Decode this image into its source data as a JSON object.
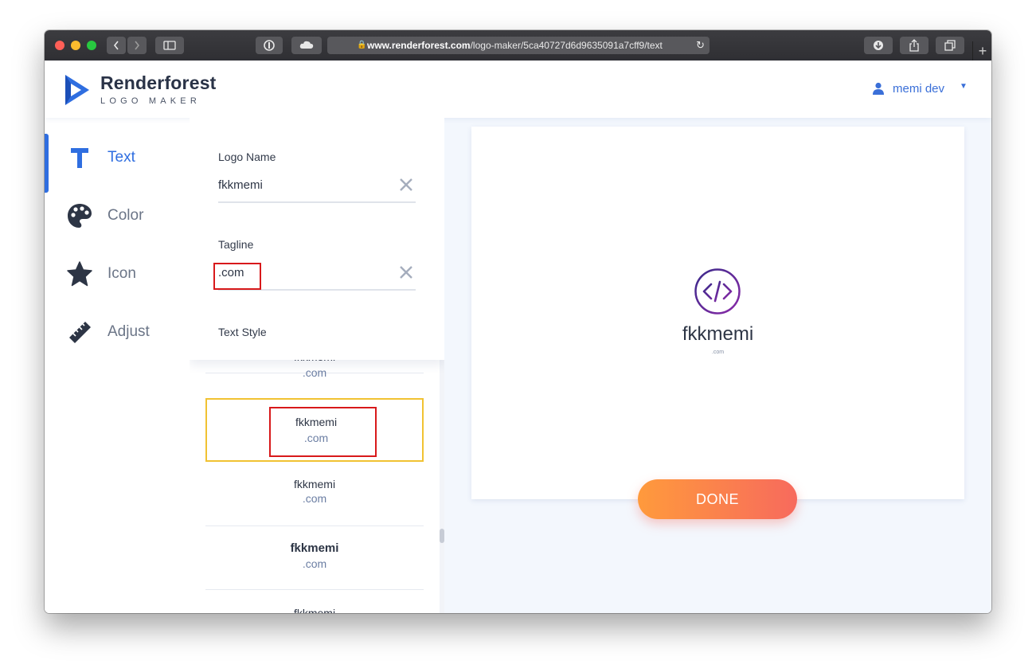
{
  "browser": {
    "url_host": "www.renderforest.com",
    "url_path": "/logo-maker/5ca40727d6d9635091a7cff9/text",
    "new_tab": "+"
  },
  "header": {
    "brand_name": "Renderforest",
    "brand_sub": "LOGO MAKER",
    "user_name": "memi dev"
  },
  "sidenav": {
    "items": [
      {
        "label": "Text",
        "icon": "text-icon",
        "active": true
      },
      {
        "label": "Color",
        "icon": "palette-icon",
        "active": false
      },
      {
        "label": "Icon",
        "icon": "star-icon",
        "active": false
      },
      {
        "label": "Adjust",
        "icon": "ruler-icon",
        "active": false
      }
    ]
  },
  "form": {
    "logo_name_label": "Logo Name",
    "logo_name_value": "fkkmemi",
    "tagline_label": "Tagline",
    "tagline_value": ".com",
    "text_style_label": "Text Style"
  },
  "styles": [
    {
      "name": "fkkmemi",
      "tag": ".com"
    },
    {
      "name": "fkkmemi",
      "tag": ".com"
    },
    {
      "name": "fkkmemi",
      "tag": ".com"
    },
    {
      "name": "fkkmemi",
      "tag": ".com"
    },
    {
      "name": "fkkmemi",
      "tag": ""
    }
  ],
  "preview": {
    "name": "fkkmemi",
    "tagline": ".com",
    "emblem_icon": "code-icon"
  },
  "done_label": "DONE",
  "colors": {
    "accent": "#2f6ee0",
    "highlight_red": "#d8191b",
    "selected_yellow": "#f1c232",
    "done_gradient_start": "#ff9a3c",
    "done_gradient_end": "#f76a5d"
  }
}
